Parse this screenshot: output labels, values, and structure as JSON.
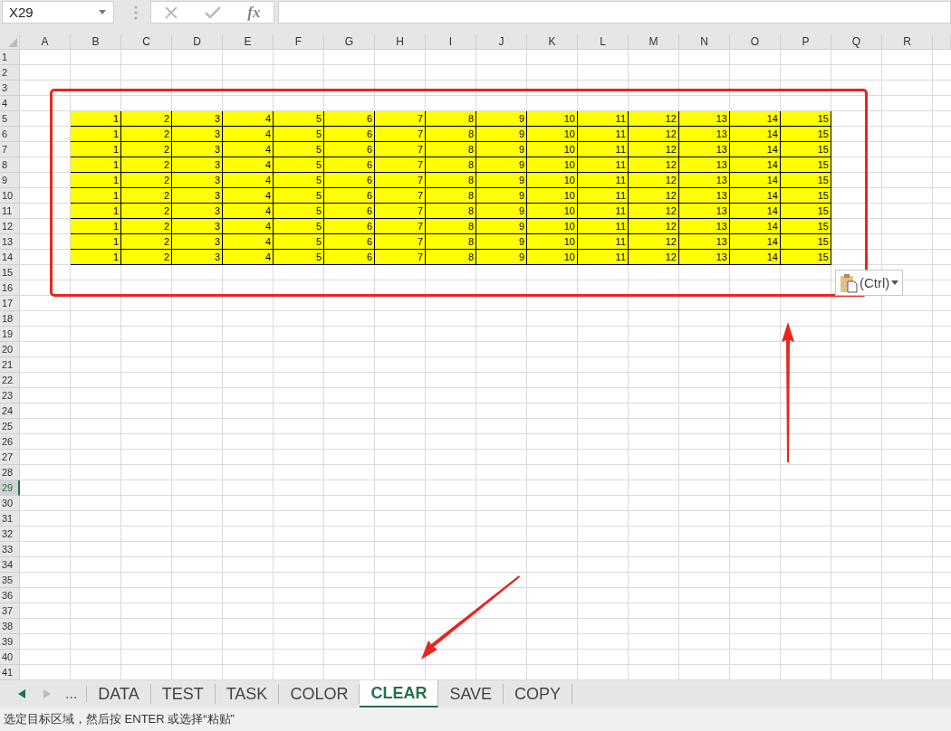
{
  "formula_bar": {
    "name_box": "X29",
    "function_label": "fx"
  },
  "column_headers": [
    "A",
    "B",
    "C",
    "D",
    "E",
    "F",
    "G",
    "H",
    "I",
    "J",
    "K",
    "L",
    "M",
    "N",
    "O",
    "P",
    "Q",
    "R"
  ],
  "row_headers": [
    {
      "label": "1",
      "selected": false
    },
    {
      "label": "2",
      "selected": false
    },
    {
      "label": "3",
      "selected": false
    },
    {
      "label": "4",
      "selected": false
    },
    {
      "label": "5",
      "selected": false
    },
    {
      "label": "6",
      "selected": false
    },
    {
      "label": "7",
      "selected": false
    },
    {
      "label": "8",
      "selected": false
    },
    {
      "label": "9",
      "selected": false
    },
    {
      "label": "10",
      "selected": false
    },
    {
      "label": "11",
      "selected": false
    },
    {
      "label": "12",
      "selected": false
    },
    {
      "label": "13",
      "selected": false
    },
    {
      "label": "14",
      "selected": false
    },
    {
      "label": "15",
      "selected": false
    },
    {
      "label": "16",
      "selected": false
    },
    {
      "label": "17",
      "selected": false
    },
    {
      "label": "18",
      "selected": false
    },
    {
      "label": "19",
      "selected": false
    },
    {
      "label": "20",
      "selected": false
    },
    {
      "label": "21",
      "selected": false
    },
    {
      "label": "22",
      "selected": false
    },
    {
      "label": "23",
      "selected": false
    },
    {
      "label": "24",
      "selected": false
    },
    {
      "label": "25",
      "selected": false
    },
    {
      "label": "26",
      "selected": false
    },
    {
      "label": "27",
      "selected": false
    },
    {
      "label": "28",
      "selected": false
    },
    {
      "label": "29",
      "selected": true
    },
    {
      "label": "30",
      "selected": false
    },
    {
      "label": "31",
      "selected": false
    },
    {
      "label": "32",
      "selected": false
    },
    {
      "label": "33",
      "selected": false
    },
    {
      "label": "34",
      "selected": false
    },
    {
      "label": "35",
      "selected": false
    },
    {
      "label": "36",
      "selected": false
    },
    {
      "label": "37",
      "selected": false
    },
    {
      "label": "38",
      "selected": false
    },
    {
      "label": "39",
      "selected": false
    },
    {
      "label": "40",
      "selected": false
    },
    {
      "label": "41",
      "selected": false
    }
  ],
  "data_block": {
    "color": "#ffff00",
    "rows": [
      [
        "1",
        "2",
        "3",
        "4",
        "5",
        "6",
        "7",
        "8",
        "9",
        "10",
        "11",
        "12",
        "13",
        "14",
        "15"
      ],
      [
        "1",
        "2",
        "3",
        "4",
        "5",
        "6",
        "7",
        "8",
        "9",
        "10",
        "11",
        "12",
        "13",
        "14",
        "15"
      ],
      [
        "1",
        "2",
        "3",
        "4",
        "5",
        "6",
        "7",
        "8",
        "9",
        "10",
        "11",
        "12",
        "13",
        "14",
        "15"
      ],
      [
        "1",
        "2",
        "3",
        "4",
        "5",
        "6",
        "7",
        "8",
        "9",
        "10",
        "11",
        "12",
        "13",
        "14",
        "15"
      ],
      [
        "1",
        "2",
        "3",
        "4",
        "5",
        "6",
        "7",
        "8",
        "9",
        "10",
        "11",
        "12",
        "13",
        "14",
        "15"
      ],
      [
        "1",
        "2",
        "3",
        "4",
        "5",
        "6",
        "7",
        "8",
        "9",
        "10",
        "11",
        "12",
        "13",
        "14",
        "15"
      ],
      [
        "1",
        "2",
        "3",
        "4",
        "5",
        "6",
        "7",
        "8",
        "9",
        "10",
        "11",
        "12",
        "13",
        "14",
        "15"
      ],
      [
        "1",
        "2",
        "3",
        "4",
        "5",
        "6",
        "7",
        "8",
        "9",
        "10",
        "11",
        "12",
        "13",
        "14",
        "15"
      ],
      [
        "1",
        "2",
        "3",
        "4",
        "5",
        "6",
        "7",
        "8",
        "9",
        "10",
        "11",
        "12",
        "13",
        "14",
        "15"
      ],
      [
        "1",
        "2",
        "3",
        "4",
        "5",
        "6",
        "7",
        "8",
        "9",
        "10",
        "11",
        "12",
        "13",
        "14",
        "15"
      ]
    ]
  },
  "paste_options": {
    "label": "(Ctrl)"
  },
  "sheet_tabs": {
    "more": "...",
    "tabs": [
      {
        "label": "DATA",
        "selected": false
      },
      {
        "label": "TEST",
        "selected": false
      },
      {
        "label": "TASK",
        "selected": false
      },
      {
        "label": "COLOR",
        "selected": false
      },
      {
        "label": "CLEAR",
        "selected": true
      },
      {
        "label": "SAVE",
        "selected": false
      },
      {
        "label": "COPY",
        "selected": false
      }
    ]
  },
  "status_bar": "选定目标区域，然后按 ENTER 或选择“粘贴”"
}
